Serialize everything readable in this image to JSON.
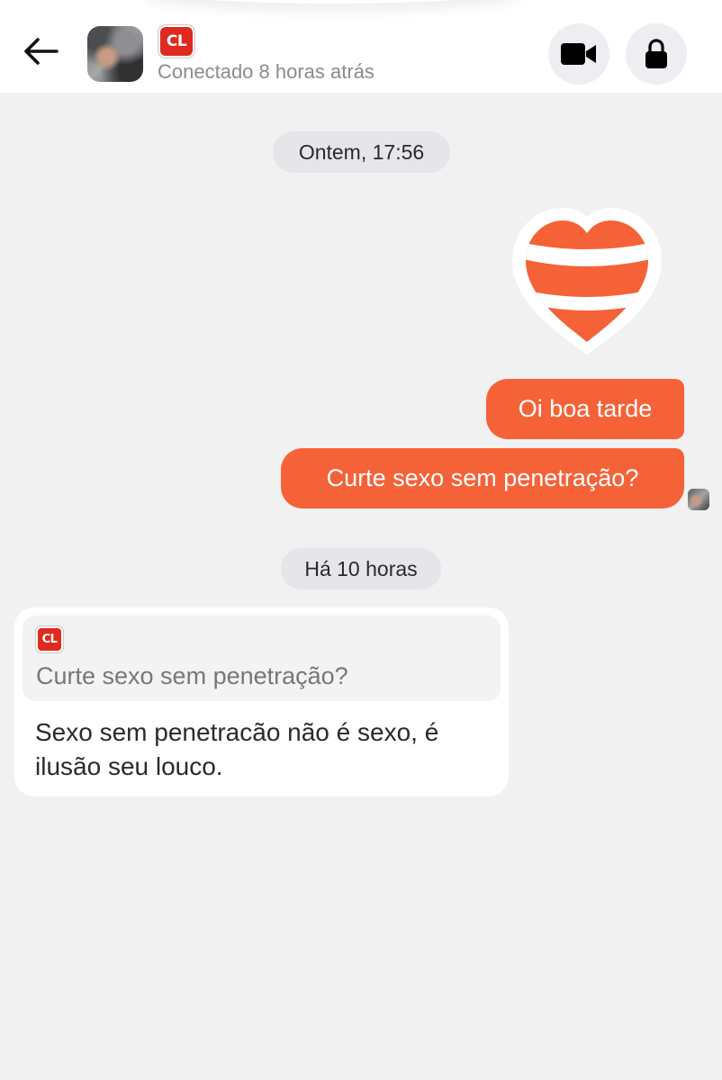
{
  "header": {
    "badge_text": "CL",
    "status": "Conectado 8 horas atrás"
  },
  "messages": {
    "separator_1": "Ontem, 17:56",
    "sent_1": "Oi boa tarde",
    "sent_2": "Curte sexo sem penetração?",
    "separator_2": "Há 10 horas",
    "reply": {
      "quote_badge": "CL",
      "quoted_text": "Curte sexo sem penetração?",
      "text": "Sexo sem penetracão não é sexo, é ilusão seu louco."
    }
  },
  "colors": {
    "accent": "#f56238",
    "badge_red": "#e02a1f",
    "background": "#f1f1f1"
  },
  "icons": [
    "back-arrow-icon",
    "video-camera-icon",
    "lock-icon",
    "heart-sticker-icon"
  ]
}
